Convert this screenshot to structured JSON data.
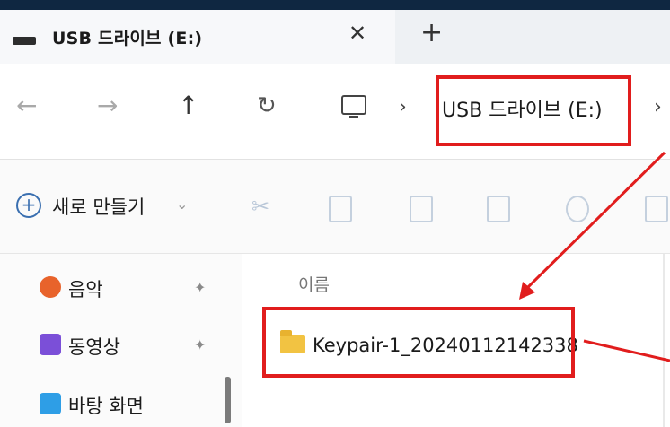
{
  "window": {
    "tab_title": "USB 드라이브 (E:)",
    "close_glyph": "✕",
    "new_tab_glyph": "+"
  },
  "navigation": {
    "back_glyph": "←",
    "forward_glyph": "→",
    "up_glyph": "↑",
    "refresh_glyph": "↻",
    "chevron": "›",
    "breadcrumb": "USB 드라이브 (E:)"
  },
  "toolbar": {
    "new_label": "새로 만들기",
    "new_caret": "⌄",
    "actions": [
      "cut-icon",
      "copy-icon",
      "paste-icon",
      "rename-icon",
      "share-icon",
      "delete-icon"
    ]
  },
  "sidebar": {
    "items": [
      {
        "label": "음악",
        "icon": "music-icon",
        "color": "#e8632b",
        "pinned": true
      },
      {
        "label": "동영상",
        "icon": "video-icon",
        "color": "#7b4fd8",
        "pinned": true
      },
      {
        "label": "바탕 화면",
        "icon": "desktop-icon",
        "color": "#2e9ee6",
        "pinned": false
      }
    ],
    "pin_glyph": "📌"
  },
  "file_list": {
    "column_header": "이름",
    "items": [
      {
        "name": "Keypair-1_20240112142338",
        "type": "folder"
      }
    ]
  },
  "annotations": {
    "highlight_color": "#e11d1d"
  }
}
